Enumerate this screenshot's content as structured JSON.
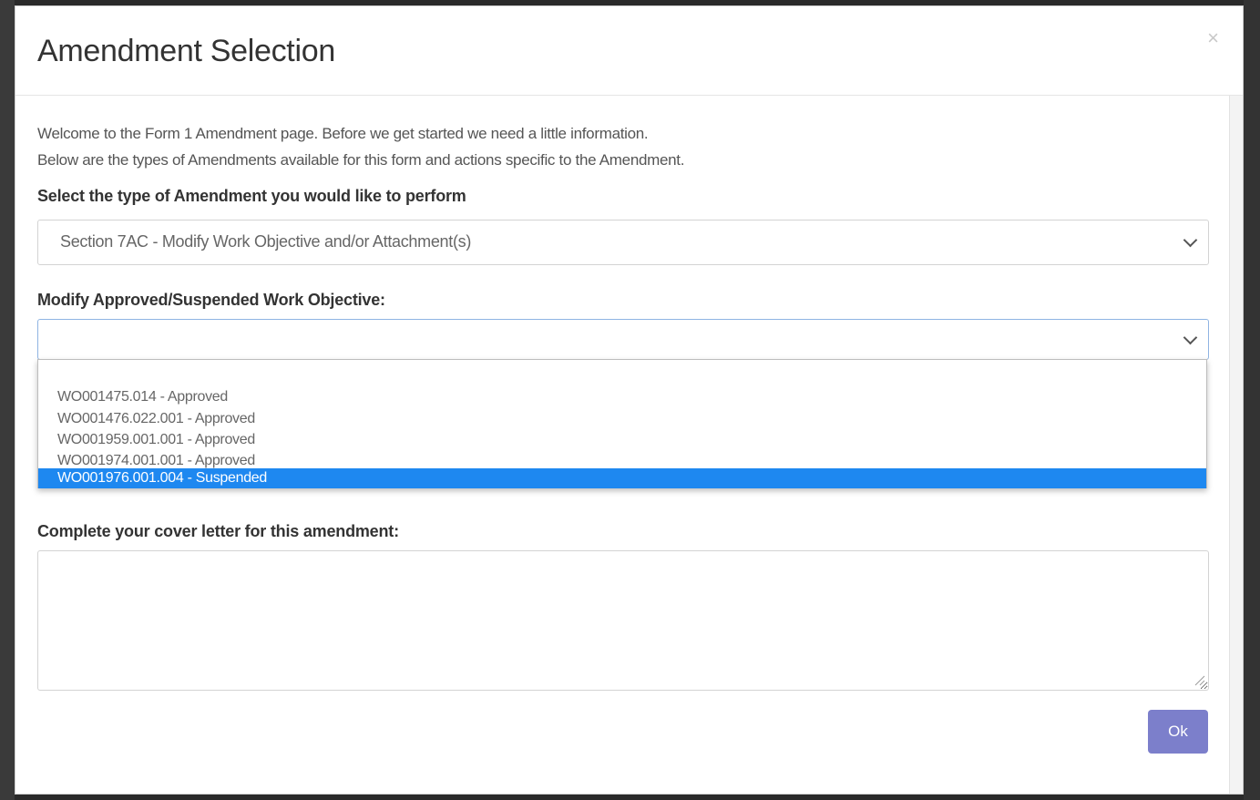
{
  "modal": {
    "title": "Amendment Selection",
    "close_label": "×"
  },
  "intro": {
    "line1": "Welcome to the Form 1 Amendment page. Before we get started we need a little information.",
    "line2": "Below are the types of Amendments available for this form and actions specific to the Amendment."
  },
  "amendment_type": {
    "label": "Select the type of Amendment you would like to perform",
    "selected_value": "Section 7AC - Modify Work Objective and/or Attachment(s)"
  },
  "work_objective": {
    "label": "Modify Approved/Suspended Work Objective:",
    "selected_value": "",
    "options": [
      "",
      "WO001475.014 - Approved",
      "WO001476.022.001 - Approved",
      "WO001959.001.001 - Approved",
      "WO001974.001.001 - Approved",
      "WO001976.001.004 - Suspended"
    ],
    "highlighted_option": "WO001976.001.004 - Suspended"
  },
  "cover_letter": {
    "label": "Complete your cover letter for this amendment:",
    "value": ""
  },
  "actions": {
    "ok_label": "Ok"
  },
  "colors": {
    "ok_button": "#7c7fcb",
    "highlight": "#1e88f0"
  }
}
